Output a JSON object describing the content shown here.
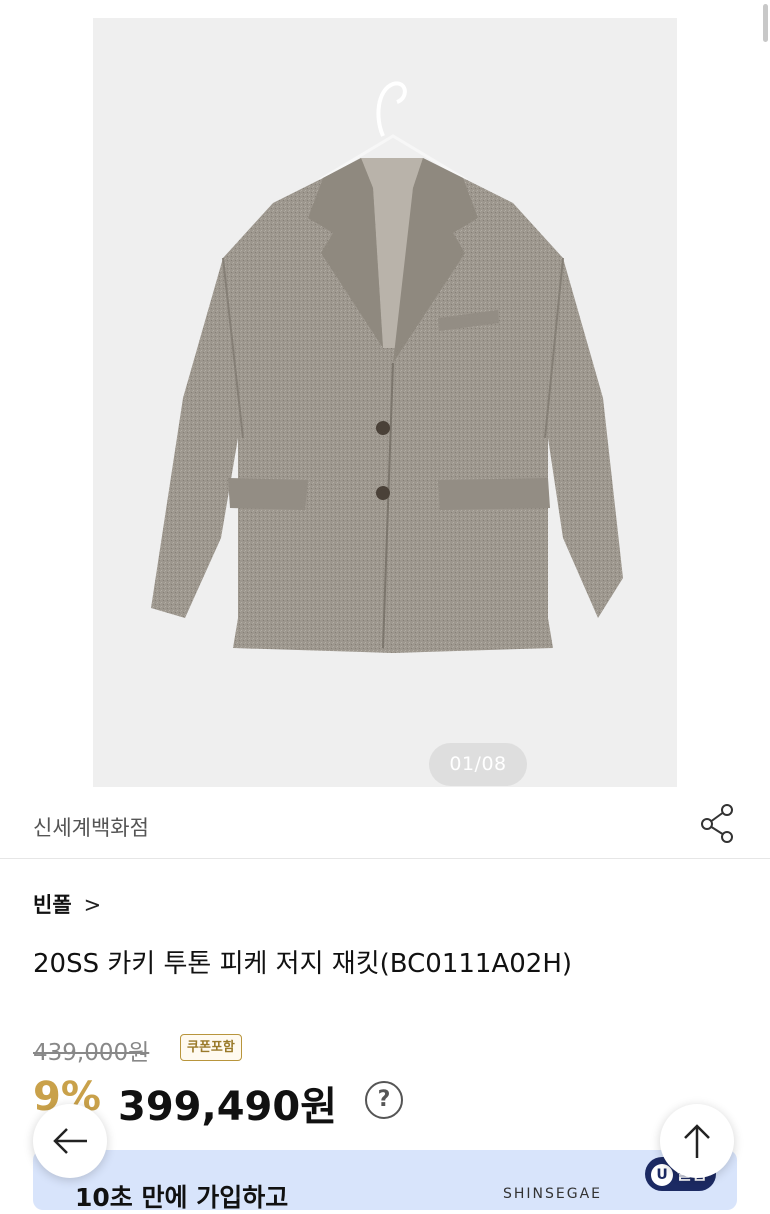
{
  "gallery": {
    "counter": "01/08",
    "image_subject": "gray-jacket-on-hanger-photo"
  },
  "seller": {
    "name": "신세계백화점",
    "share_icon": "share-icon"
  },
  "product": {
    "brand": "빈폴",
    "brand_chevron": ">",
    "title": "20SS 카키 투톤 피케 저지 재킷(BC0111A02H)"
  },
  "price": {
    "original": "439,000원",
    "coupon_badge": "쿠폰포함",
    "discount": "9%",
    "sale": "399,490원",
    "help_icon_label": "?"
  },
  "banner": {
    "text": "10초 만에 가입하고",
    "brand": "SHINSEGAE",
    "club_label": "클럽",
    "club_letter": "U"
  },
  "colors": {
    "accent_gold": "#c9a14a",
    "banner_bg": "#d8e4fb",
    "club_navy": "#1c2a63"
  }
}
